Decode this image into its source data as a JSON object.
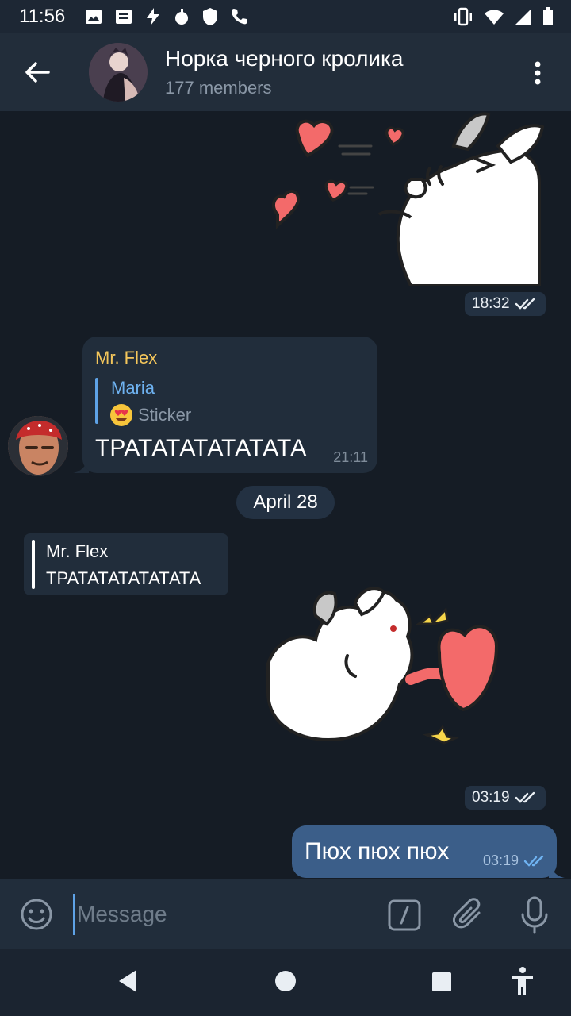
{
  "status": {
    "time": "11:56"
  },
  "header": {
    "title": "Норка черного кролика",
    "subtitle": "177 members"
  },
  "messages": {
    "sticker1_time": "18:32",
    "incoming": {
      "sender": "Mr. Flex",
      "reply_name": "Maria",
      "reply_text": "Sticker",
      "text": "ТРАТАТАТАТАТАТА",
      "time": "21:11"
    },
    "date_separator": "April 28",
    "quote": {
      "name": "Mr. Flex",
      "text": "ТРАТАТАТАТАТАТА"
    },
    "sticker2_time": "03:19",
    "outgoing": {
      "text": "Пюх пюх пюх",
      "time": "03:19"
    }
  },
  "input": {
    "placeholder": "Message"
  },
  "colors": {
    "header_bg": "#222d3a",
    "chat_bg": "#151c25",
    "bubble_in": "#212d3b",
    "bubble_out": "#3b5e89",
    "sender_name": "#f4c65b",
    "reply_accent": "#5ea2e6"
  },
  "icons": {
    "back": "arrow-left-icon",
    "menu": "more-vertical-icon",
    "emoji": "smiley-icon",
    "commands": "slash-command-icon",
    "attach": "paperclip-icon",
    "mic": "microphone-icon",
    "checks": "double-check-icon"
  }
}
